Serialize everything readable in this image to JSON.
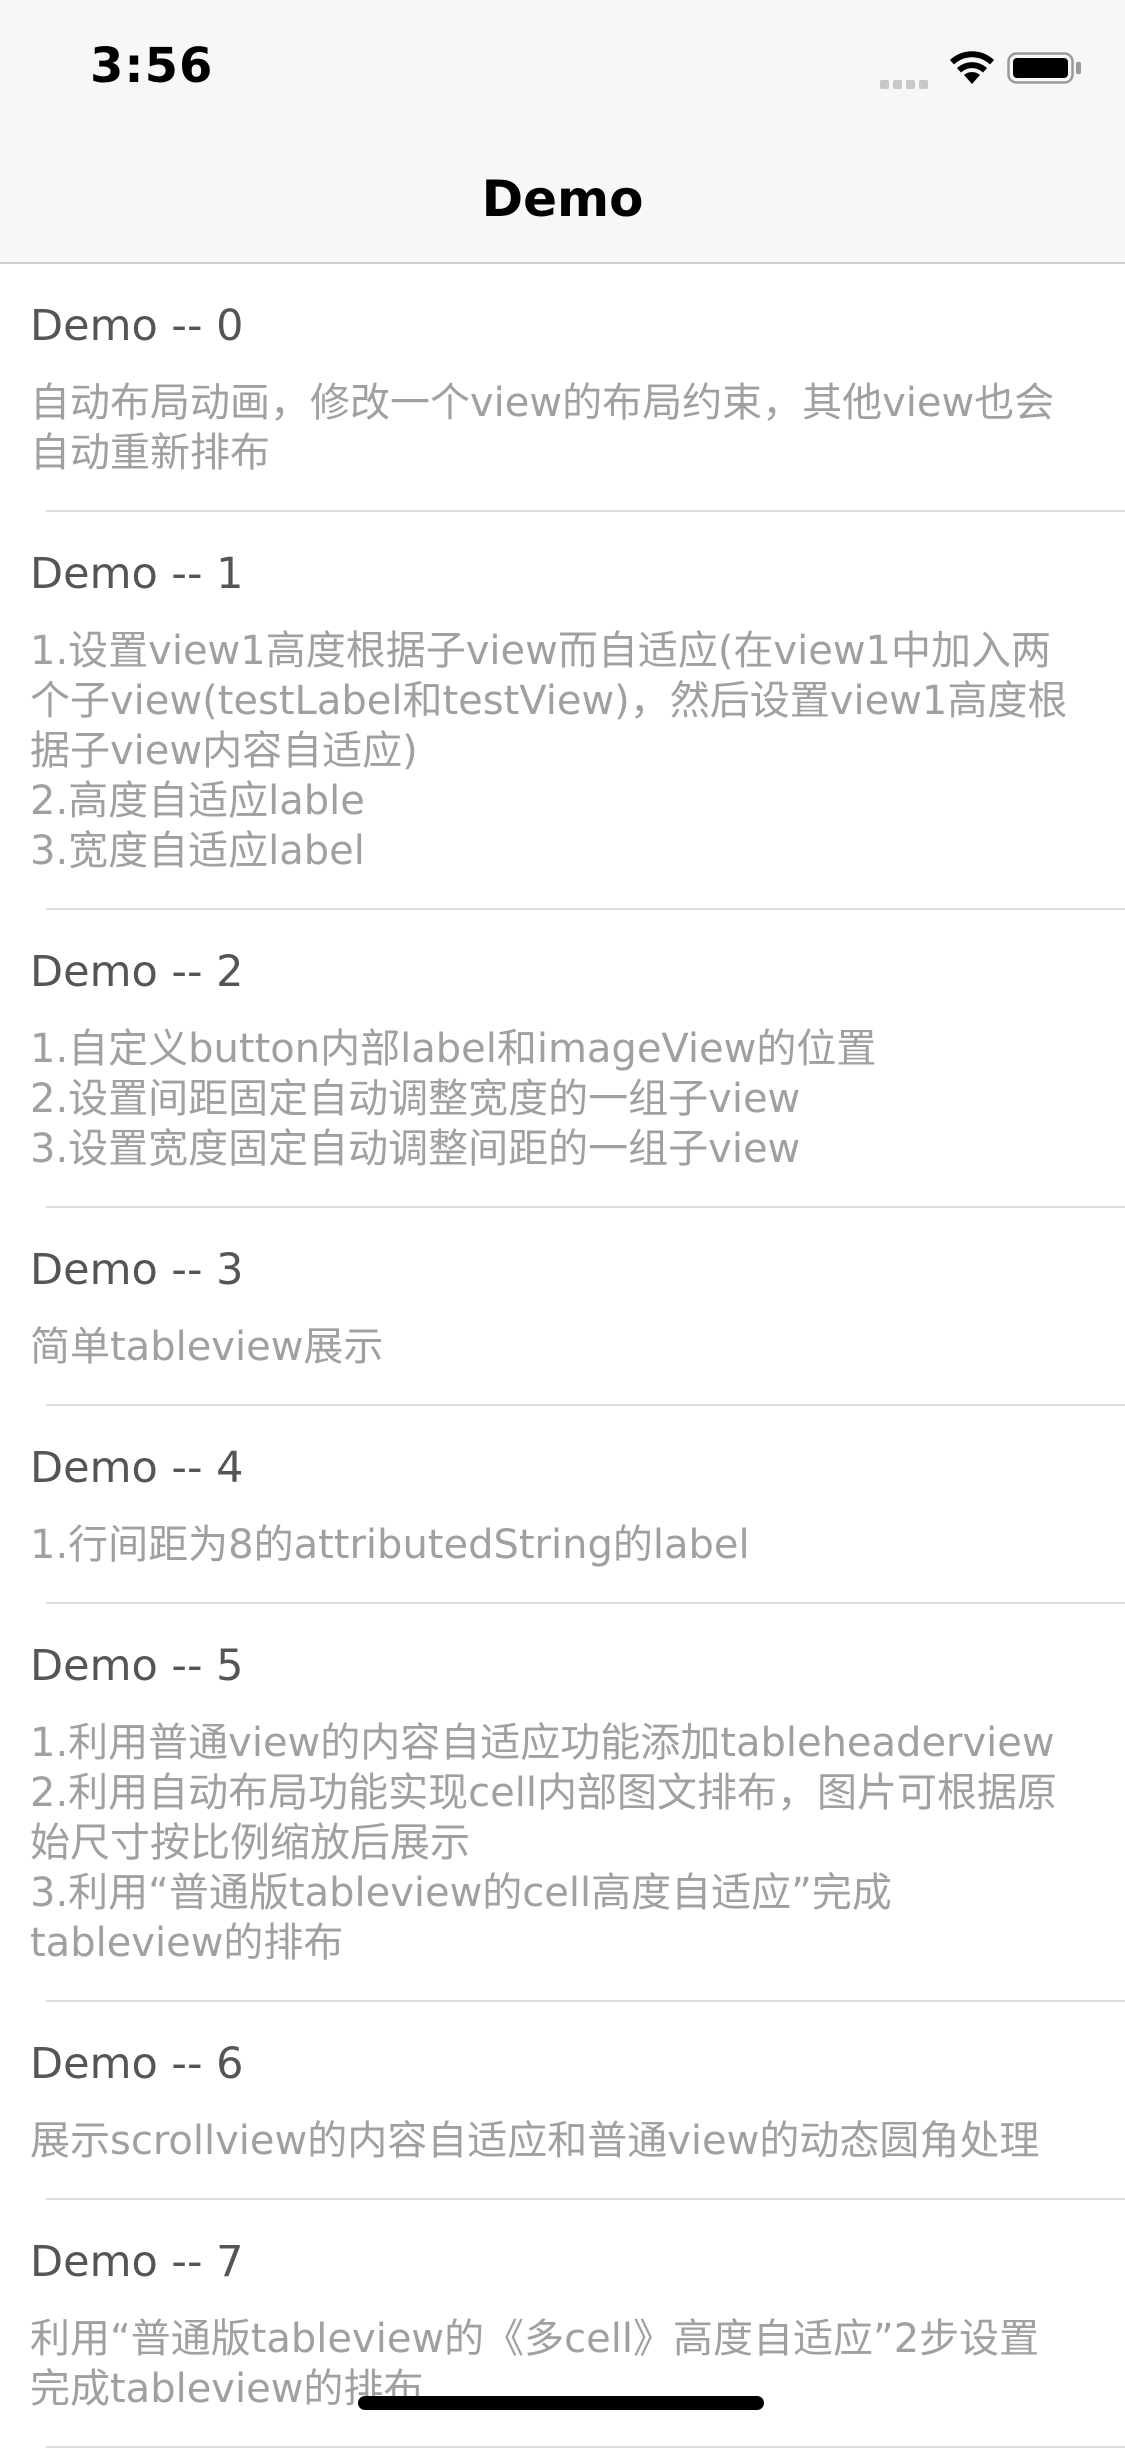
{
  "status_bar": {
    "time": "3:56"
  },
  "nav": {
    "title": "Demo"
  },
  "rows": [
    {
      "title": "Demo -- 0",
      "desc": "自动布局动画，修改一个view的布局约束，其他view也会自动重新排布"
    },
    {
      "title": "Demo -- 1",
      "desc": "1.设置view1高度根据子view而自适应(在view1中加入两个子view(testLabel和testView)，然后设置view1高度根据子view内容自适应)\n2.高度自适应lable\n3.宽度自适应label"
    },
    {
      "title": "Demo -- 2",
      "desc": "1.自定义button内部label和imageView的位置\n2.设置间距固定自动调整宽度的一组子view\n3.设置宽度固定自动调整间距的一组子view"
    },
    {
      "title": "Demo -- 3",
      "desc": "简单tableview展示"
    },
    {
      "title": "Demo -- 4",
      "desc": "1.行间距为8的attributedString的label"
    },
    {
      "title": "Demo -- 5",
      "desc": "1.利用普通view的内容自适应功能添加tableheaderview\n2.利用自动布局功能实现cell内部图文排布，图片可根据原始尺寸按比例缩放后展示\n3.利用“普通版tableview的cell高度自适应”完成tableview的排布"
    },
    {
      "title": "Demo -- 6",
      "desc": "展示scrollview的内容自适应和普通view的动态圆角处理"
    },
    {
      "title": "Demo -- 7",
      "desc": "利用“普通版tableview的《多cell》高度自适应”2步设置完成tableview的排布"
    }
  ]
}
